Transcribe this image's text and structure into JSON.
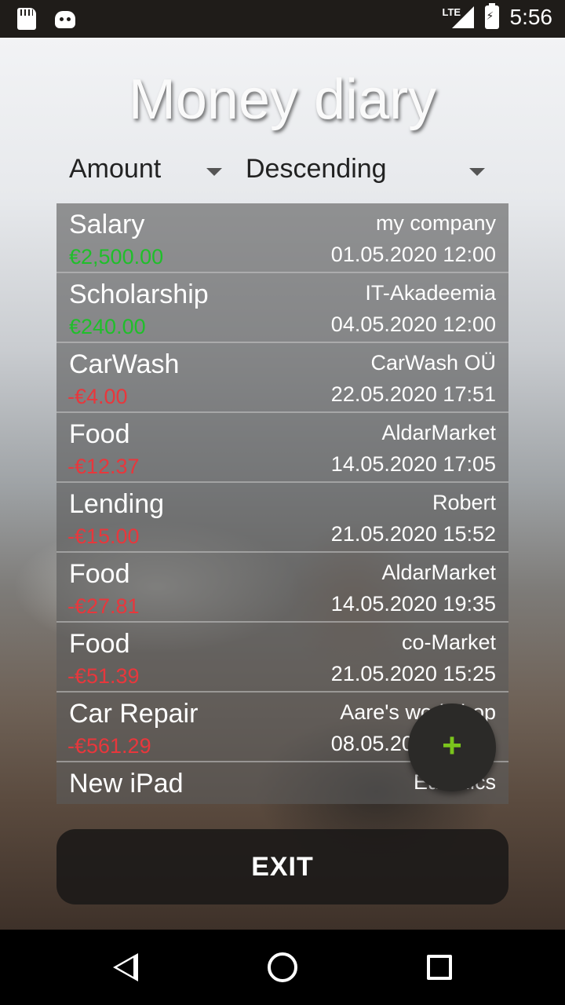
{
  "status_bar": {
    "network": "LTE",
    "time": "5:56"
  },
  "app": {
    "title": "Money diary"
  },
  "sort": {
    "field": "Amount",
    "order": "Descending"
  },
  "transactions": [
    {
      "name": "Salary",
      "amount": "€2,500.00",
      "sign": "pos",
      "payee": "my company",
      "date": "01.05.2020 12:00"
    },
    {
      "name": "Scholarship",
      "amount": "€240.00",
      "sign": "pos",
      "payee": "IT-Akadeemia",
      "date": "04.05.2020 12:00"
    },
    {
      "name": "CarWash",
      "amount": "-€4.00",
      "sign": "neg",
      "payee": "CarWash OÜ",
      "date": "22.05.2020 17:51"
    },
    {
      "name": "Food",
      "amount": "-€12.37",
      "sign": "neg",
      "payee": "AldarMarket",
      "date": "14.05.2020 17:05"
    },
    {
      "name": "Lending",
      "amount": "-€15.00",
      "sign": "neg",
      "payee": "Robert",
      "date": "21.05.2020 15:52"
    },
    {
      "name": "Food",
      "amount": "-€27.81",
      "sign": "neg",
      "payee": "AldarMarket",
      "date": "14.05.2020 19:35"
    },
    {
      "name": "Food",
      "amount": "-€51.39",
      "sign": "neg",
      "payee": "co-Market",
      "date": "21.05.2020 15:25"
    },
    {
      "name": "Car Repair",
      "amount": "-€561.29",
      "sign": "neg",
      "payee": "Aare's workshop",
      "date": "08.05.2020 12:00"
    },
    {
      "name": "New iPad",
      "amount": "",
      "sign": "neg",
      "payee": "Euronics",
      "date": ""
    }
  ],
  "fab": {
    "label": "+",
    "icon": "plus-icon"
  },
  "exit_button": {
    "label": "EXIT"
  },
  "colors": {
    "positive": "#1fbf2a",
    "negative": "#e8373c",
    "fab_plus": "#7ac41c"
  }
}
